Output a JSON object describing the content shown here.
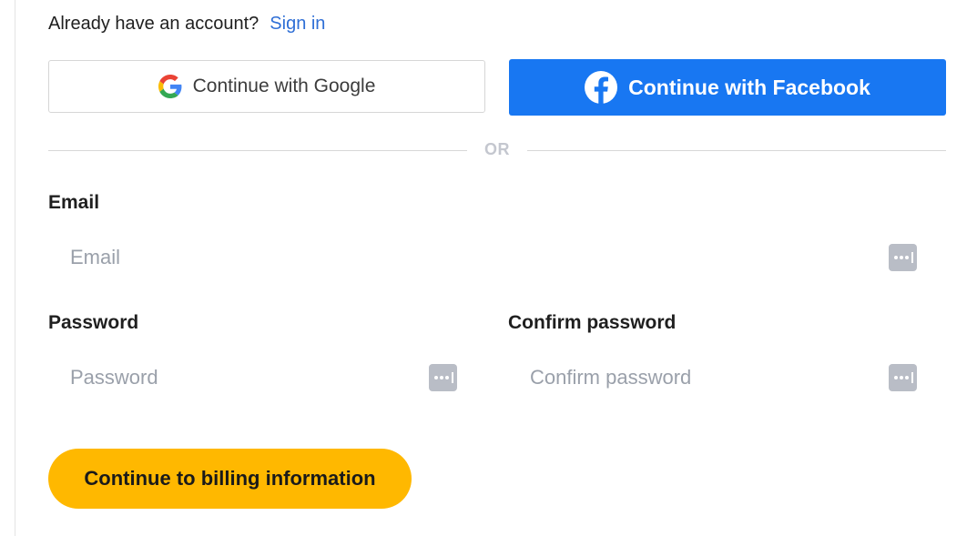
{
  "signin": {
    "prompt": "Already have an account?",
    "link_label": "Sign in"
  },
  "social": {
    "google_label": "Continue with Google",
    "facebook_label": "Continue with Facebook",
    "google_icon": "google-g-icon",
    "facebook_icon": "facebook-f-icon"
  },
  "divider": {
    "label": "OR"
  },
  "form": {
    "email": {
      "label": "Email",
      "placeholder": "Email",
      "value": ""
    },
    "password": {
      "label": "Password",
      "placeholder": "Password",
      "value": ""
    },
    "confirm_password": {
      "label": "Confirm password",
      "placeholder": "Confirm password",
      "value": ""
    },
    "password_manager_icon": "password-dots-icon"
  },
  "cta": {
    "label": "Continue to billing information"
  },
  "colors": {
    "link": "#2f6fd6",
    "facebook": "#1877f2",
    "cta": "#ffb800",
    "divider_text": "#c4c7cf",
    "placeholder": "#9aa0aa",
    "icon_grey": "#b9bdc6"
  }
}
